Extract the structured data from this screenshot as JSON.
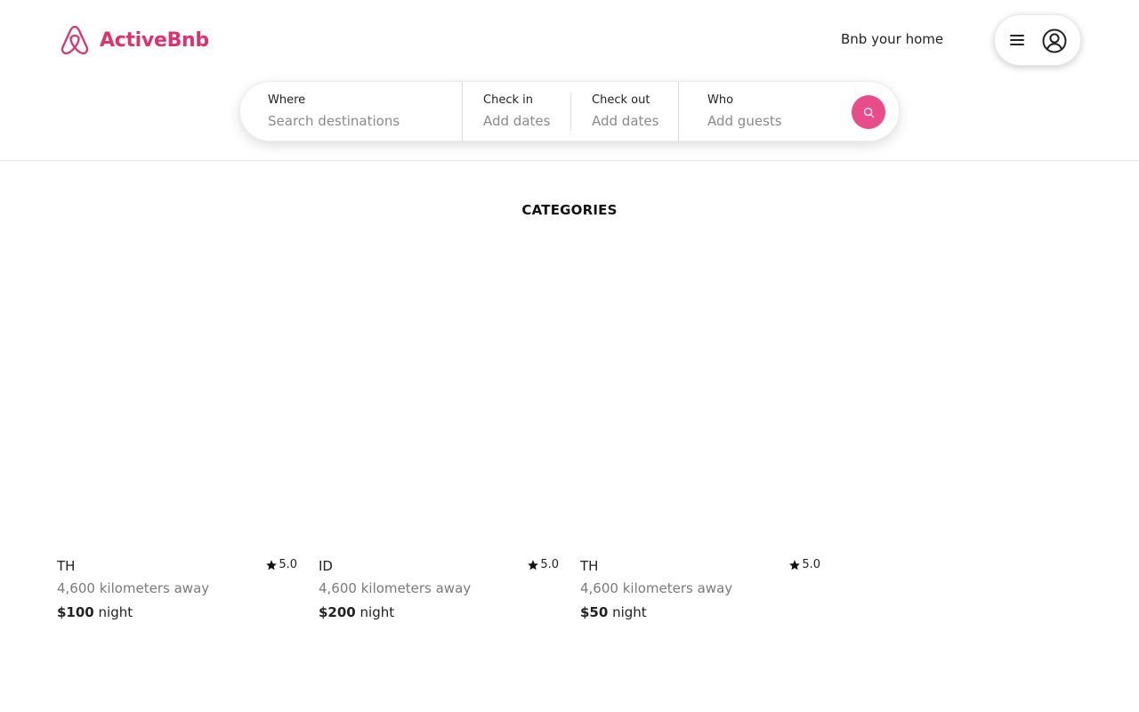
{
  "brand": {
    "name": "ActiveBnb",
    "color": "#de3270"
  },
  "header": {
    "host_link": "Bnb your home"
  },
  "user_menu": {
    "menu_icon": "hamburger-icon",
    "avatar_icon": "user-circle-icon"
  },
  "search": {
    "where_label": "Where",
    "where_placeholder": "Search destinations",
    "checkin_label": "Check in",
    "checkin_placeholder": "Add dates",
    "checkout_label": "Check out",
    "checkout_placeholder": "Add dates",
    "who_label": "Who",
    "who_placeholder": "Add guests",
    "button_color": "#e84c8a",
    "button_icon": "search-icon"
  },
  "categories": {
    "title": "CATEGORIES"
  },
  "listings": [
    {
      "country": "TH",
      "rating": "5.0",
      "distance": "4,600 kilometers away",
      "price": "$100",
      "price_unit": "night"
    },
    {
      "country": "ID",
      "rating": "5.0",
      "distance": "4,600 kilometers away",
      "price": "$200",
      "price_unit": "night"
    },
    {
      "country": "TH",
      "rating": "5.0",
      "distance": "4,600 kilometers away",
      "price": "$50",
      "price_unit": "night"
    }
  ]
}
